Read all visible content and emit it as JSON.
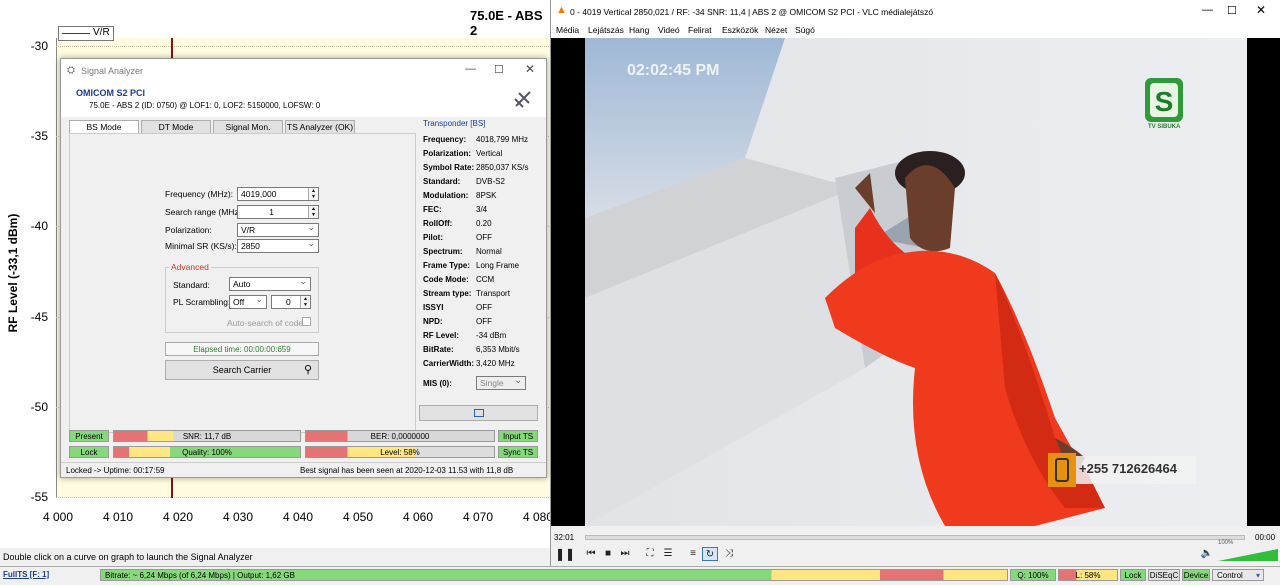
{
  "graph": {
    "title": "75.0E - ABS 2",
    "ylabel": "RF Level (-33,1 dBm)",
    "legend": "V/R",
    "yticks": [
      "-30",
      "-35",
      "-40",
      "-45",
      "-50",
      "-55"
    ],
    "xticks": [
      "4 000",
      "4 010",
      "4 020",
      "4 030",
      "4 040",
      "4 050",
      "4 060",
      "4 070",
      "4 080"
    ]
  },
  "sa": {
    "title": "Signal Analyzer",
    "device": "OMICOM S2 PCI",
    "subtitle": "75.0E - ABS 2 (ID: 0750) @ LOF1: 0, LOF2: 5150000, LOFSW: 0",
    "tabs": [
      "BS Mode",
      "DT Mode",
      "Signal Mon.",
      "TS Analyzer (OK)"
    ],
    "freq_label": "Frequency (MHz):",
    "freq_value": "4019,000",
    "range_label": "Search range (MHz):",
    "range_value": "1",
    "pol_label": "Polarization:",
    "pol_value": "V/R",
    "sr_label": "Minimal SR (KS/s):",
    "sr_value": "2850",
    "advanced": "Advanced",
    "std_label": "Standard:",
    "std_value": "Auto",
    "pls_label": "PL Scrambling:",
    "pls_value": "Off",
    "pls_num": "0",
    "autosearch": "Auto-search of code",
    "elapsed": "Elapsed time: 00:00:00:659",
    "search_btn": "Search Carrier",
    "tp_title": "Transponder [BS]",
    "tp_rows": [
      [
        "Frequency:",
        "4018,799 MHz"
      ],
      [
        "Polarization:",
        "Vertical"
      ],
      [
        "Symbol Rate:",
        "2850,037 KS/s"
      ],
      [
        "Standard:",
        "DVB-S2"
      ],
      [
        "Modulation:",
        "8PSK"
      ],
      [
        "FEC:",
        "3/4"
      ],
      [
        "RollOff:",
        "0.20"
      ],
      [
        "Pilot:",
        "OFF"
      ],
      [
        "Spectrum:",
        "Normal"
      ],
      [
        "Frame Type:",
        "Long Frame"
      ],
      [
        "Code Mode:",
        "CCM"
      ],
      [
        "Stream type:",
        "Transport"
      ],
      [
        "ISSYI",
        "OFF"
      ],
      [
        "NPD:",
        "OFF"
      ],
      [
        "RF Level:",
        "-34 dBm"
      ],
      [
        "BitRate:",
        "6,353 Mbit/s"
      ],
      [
        "CarrierWidth:",
        "3,420 MHz"
      ]
    ],
    "mis_label": "MIS (0):",
    "mis_value": "Single",
    "present": "Present",
    "lock": "Lock",
    "input_ts": "Input TS",
    "sync_ts": "Sync TS",
    "snr": "SNR: 11,7 dB",
    "ber": "BER: 0,0000000",
    "quality": "Quality: 100%",
    "level": "Level: 58%",
    "quality_pct": 100,
    "level_pct": 58,
    "footer_left": "Locked -> Uptime: 00:17:59",
    "footer_right": "Best signal has been seen at 2020-12-03 11.53 with 11,8 dB"
  },
  "vlc": {
    "title": "0 - 4019 Vertical 2850,021 / RF: -34 SNR: 11,4 | ABS 2 @ OMICOM S2 PCI - VLC médialejátszó",
    "menu": [
      "Média",
      "Lejátszás",
      "Hang",
      "Videó",
      "Felirat",
      "Eszközök",
      "Nézet",
      "Súgó"
    ],
    "time_left": "32:01",
    "time_right": "00:00",
    "osd_time": "02:02:45 PM",
    "logo_text": "TV SIBUKA",
    "phone": "+255 712626464",
    "volume": "100%"
  },
  "hint": "Double click on a curve on graph to launch the Signal Analyzer",
  "status": {
    "fullts": "FullTS [F: 1]",
    "bitrate": "Bitrate: ~ 6,24 Mbps (of 6,24 Mbps) | Output: 1,62 GB",
    "q": "Q: 100%",
    "l": "L: 58%",
    "lock": "Lock",
    "diseqc": "DiSEqC",
    "device": "Device",
    "control": "Control"
  }
}
